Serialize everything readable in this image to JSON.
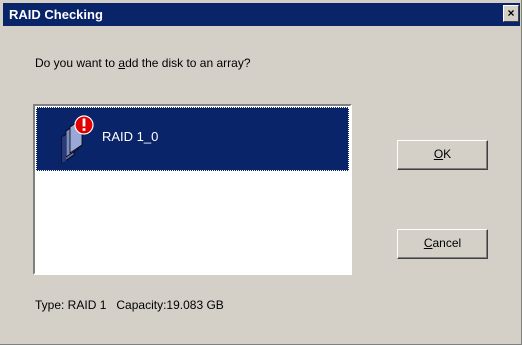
{
  "window": {
    "title": "RAID Checking",
    "close_label": "×"
  },
  "prompt": {
    "before": "Do you want to ",
    "mnemonic": "a",
    "after": "dd the disk to an array?"
  },
  "list": {
    "items": [
      {
        "label": "RAID 1_0",
        "icon": "raid-disk-warning-icon",
        "selected": true
      }
    ]
  },
  "buttons": {
    "ok": {
      "mnemonic": "O",
      "rest": "K"
    },
    "cancel": {
      "mnemonic": "C",
      "rest": "ancel"
    }
  },
  "info": {
    "type_label": "Type: RAID 1",
    "capacity_label": "Capacity:19.083 GB"
  },
  "colors": {
    "titlebar": "#0a246a",
    "selection": "#0a246a",
    "dialog_bg": "#d4d0c8",
    "warning": "#e00000"
  }
}
